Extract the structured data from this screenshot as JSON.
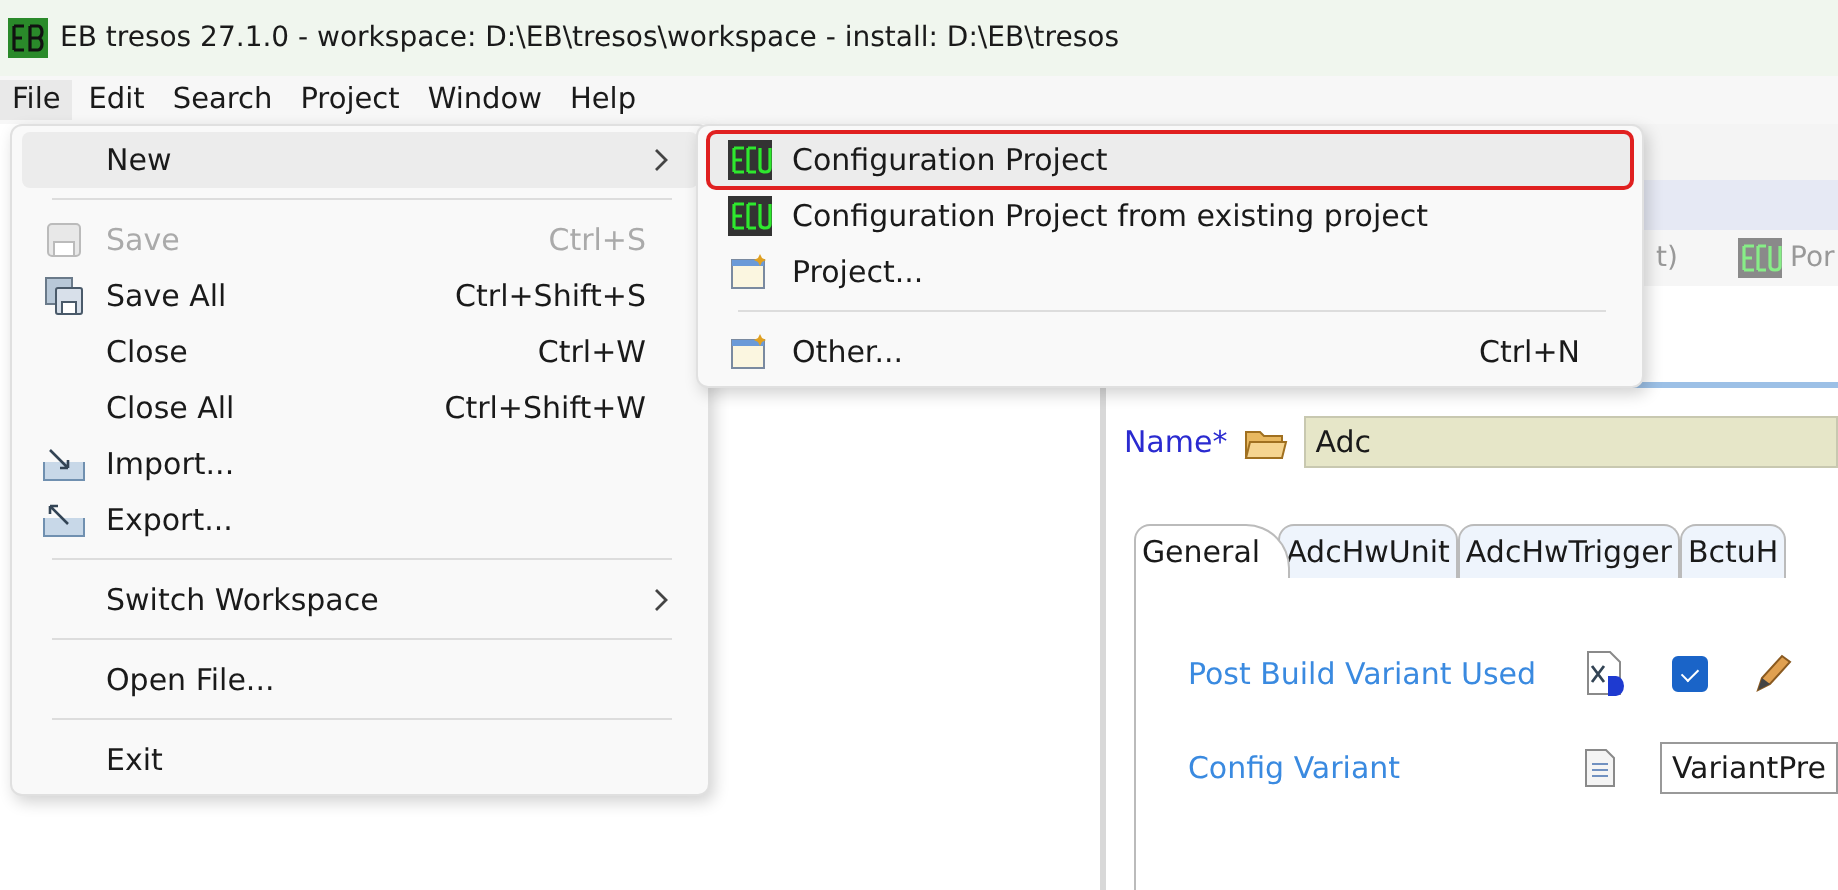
{
  "window": {
    "title": "EB tresos 27.1.0 - workspace: D:\\EB\\tresos\\workspace - install: D:\\EB\\tresos"
  },
  "menubar": [
    {
      "label": "File",
      "selected": true
    },
    {
      "label": "Edit",
      "selected": false
    },
    {
      "label": "Search",
      "selected": false
    },
    {
      "label": "Project",
      "selected": false
    },
    {
      "label": "Window",
      "selected": false
    },
    {
      "label": "Help",
      "selected": false
    }
  ],
  "file_menu": [
    {
      "kind": "item",
      "label": "New",
      "highlighted": true,
      "disabled": false,
      "submenu": true
    },
    {
      "kind": "separator"
    },
    {
      "kind": "item",
      "label": "Save",
      "shortcut": "Ctrl+S",
      "highlighted": false,
      "disabled": true,
      "submenu": false
    },
    {
      "kind": "item",
      "label": "Save All",
      "shortcut": "Ctrl+Shift+S",
      "highlighted": false,
      "disabled": false,
      "submenu": false
    },
    {
      "kind": "item",
      "label": "Close",
      "shortcut": "Ctrl+W",
      "highlighted": false,
      "disabled": false,
      "submenu": false
    },
    {
      "kind": "item",
      "label": "Close All",
      "shortcut": "Ctrl+Shift+W",
      "highlighted": false,
      "disabled": false,
      "submenu": false
    },
    {
      "kind": "item",
      "label": "Import...",
      "highlighted": false,
      "disabled": false,
      "submenu": false
    },
    {
      "kind": "item",
      "label": "Export...",
      "highlighted": false,
      "disabled": false,
      "submenu": false
    },
    {
      "kind": "separator"
    },
    {
      "kind": "item",
      "label": "Switch Workspace",
      "highlighted": false,
      "disabled": false,
      "submenu": true
    },
    {
      "kind": "separator"
    },
    {
      "kind": "item",
      "label": "Open File...",
      "highlighted": false,
      "disabled": false,
      "submenu": false
    },
    {
      "kind": "separator"
    },
    {
      "kind": "item",
      "label": "Exit",
      "highlighted": false,
      "disabled": false,
      "submenu": false
    }
  ],
  "new_submenu": [
    {
      "kind": "item",
      "label": "Configuration Project",
      "highlighted": true,
      "outlined": true
    },
    {
      "kind": "item",
      "label": "Configuration Project from existing project",
      "highlighted": false,
      "outlined": false
    },
    {
      "kind": "item",
      "label": "Project...",
      "highlighted": false,
      "outlined": false
    },
    {
      "kind": "separator"
    },
    {
      "kind": "item",
      "label": "Other...",
      "shortcut": "Ctrl+N",
      "highlighted": false,
      "outlined": false
    }
  ],
  "toolbar": [
    "t)",
    "Por"
  ],
  "editor": {
    "name_label": "Name*",
    "name_value": "Adc",
    "tabs": [
      {
        "label": "General",
        "selected": true
      },
      {
        "label": "AdcHwUnit",
        "selected": false
      },
      {
        "label": "AdcHwTrigger",
        "selected": false
      },
      {
        "label": "BctuH",
        "selected": false
      }
    ],
    "params": [
      {
        "kind": "checkbox",
        "label": "Post Build Variant Used",
        "checked": true
      },
      {
        "kind": "combo",
        "label": "Config Variant",
        "value": "VariantPre"
      }
    ]
  }
}
